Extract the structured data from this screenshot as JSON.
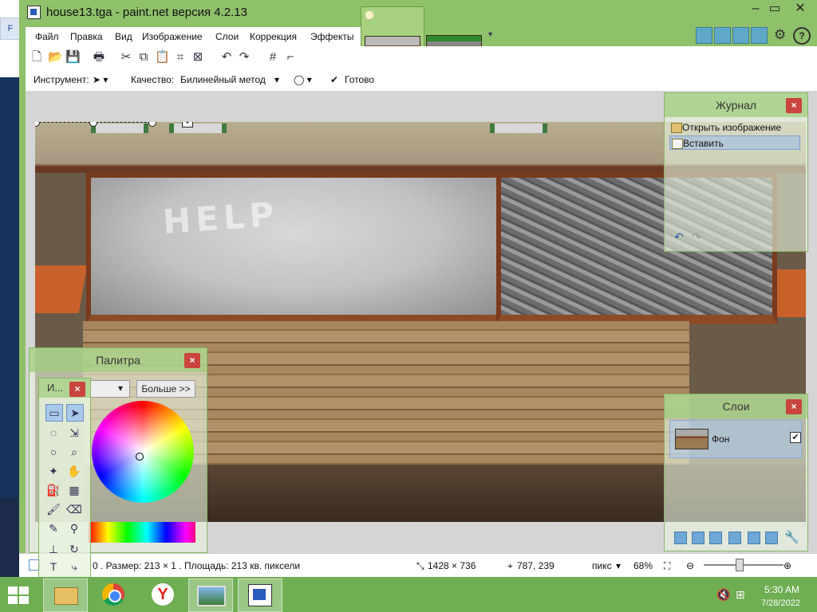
{
  "window": {
    "title": "house13.tga - paint.net версия 4.2.13"
  },
  "background_window": {
    "tab_label": "F"
  },
  "menu": {
    "items": [
      "Файл",
      "Правка",
      "Вид",
      "Изображение",
      "Слои",
      "Коррекция",
      "Эффекты"
    ]
  },
  "toolbar": {
    "tool_label": "Инструмент:",
    "quality_label": "Качество:",
    "quality_value": "Билинейный метод",
    "done_label": "Готово"
  },
  "history": {
    "title": "Журнал",
    "items": [
      "Открыть изображение",
      "Вставить"
    ]
  },
  "layers": {
    "title": "Слои",
    "items": [
      {
        "name": "Фон",
        "visible": true
      }
    ]
  },
  "palette": {
    "title": "Палитра",
    "more_label": "Больше >>"
  },
  "tools_panel": {
    "title": "И..."
  },
  "status": {
    "selection_info": "0 . Размер: 213  × 1 . Площадь: 213 кв. пиксели",
    "image_size": "1428 × 736",
    "cursor_pos": "787, 239",
    "units": "пикс",
    "zoom": "68%"
  },
  "canvas": {
    "graffiti_text": "HELP"
  },
  "taskbar": {
    "time": "5:30 AM",
    "date": "7/28/2022"
  },
  "colors": {
    "window_chrome": "#8fc06a",
    "taskbar": "#6fae52",
    "close_button": "#c9453e"
  }
}
